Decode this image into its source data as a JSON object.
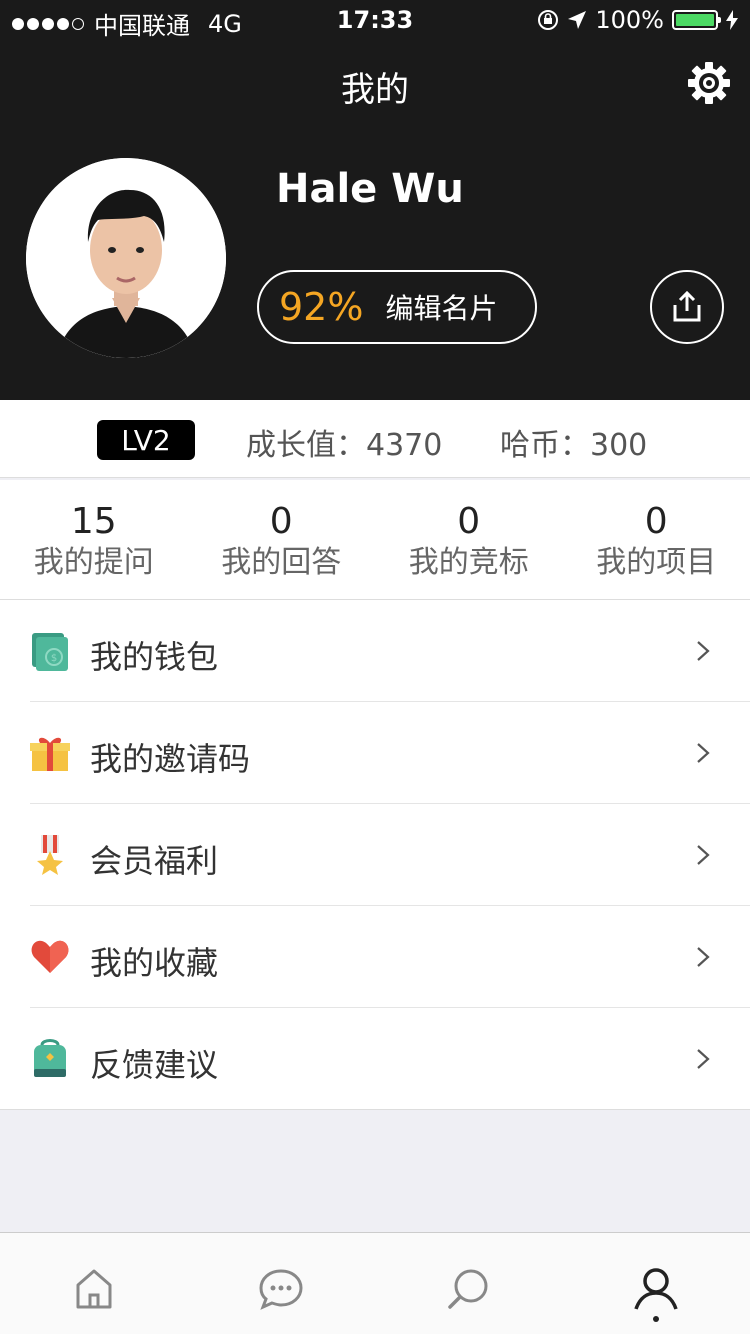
{
  "status_bar": {
    "carrier": "中国联通",
    "network": "4G",
    "time": "17:33",
    "battery": "100%",
    "signal_bars": 4
  },
  "nav": {
    "title": "我的",
    "settings_icon": "gear-icon"
  },
  "profile": {
    "name": "Hale Wu",
    "completion": "92%",
    "edit_label": "编辑名片",
    "share_icon": "share-icon",
    "accent": "#f5a623"
  },
  "level": {
    "badge": "LV2",
    "growth_label": "成长值：",
    "growth_value": "4370",
    "coins_label": "哈币：",
    "coins_value": "300"
  },
  "stats": [
    {
      "value": "15",
      "label": "我的提问"
    },
    {
      "value": "0",
      "label": "我的回答"
    },
    {
      "value": "0",
      "label": "我的竞标"
    },
    {
      "value": "0",
      "label": "我的项目"
    }
  ],
  "menu": [
    {
      "label": "我的钱包",
      "icon": "wallet-icon"
    },
    {
      "label": "我的邀请码",
      "icon": "gift-icon"
    },
    {
      "label": "会员福利",
      "icon": "medal-icon"
    },
    {
      "label": "我的收藏",
      "icon": "heart-icon"
    },
    {
      "label": "反馈建议",
      "icon": "backpack-icon"
    }
  ],
  "tabbar": [
    {
      "icon": "home-icon"
    },
    {
      "icon": "chat-icon"
    },
    {
      "icon": "discover-icon"
    },
    {
      "icon": "profile-icon",
      "active": true
    }
  ]
}
